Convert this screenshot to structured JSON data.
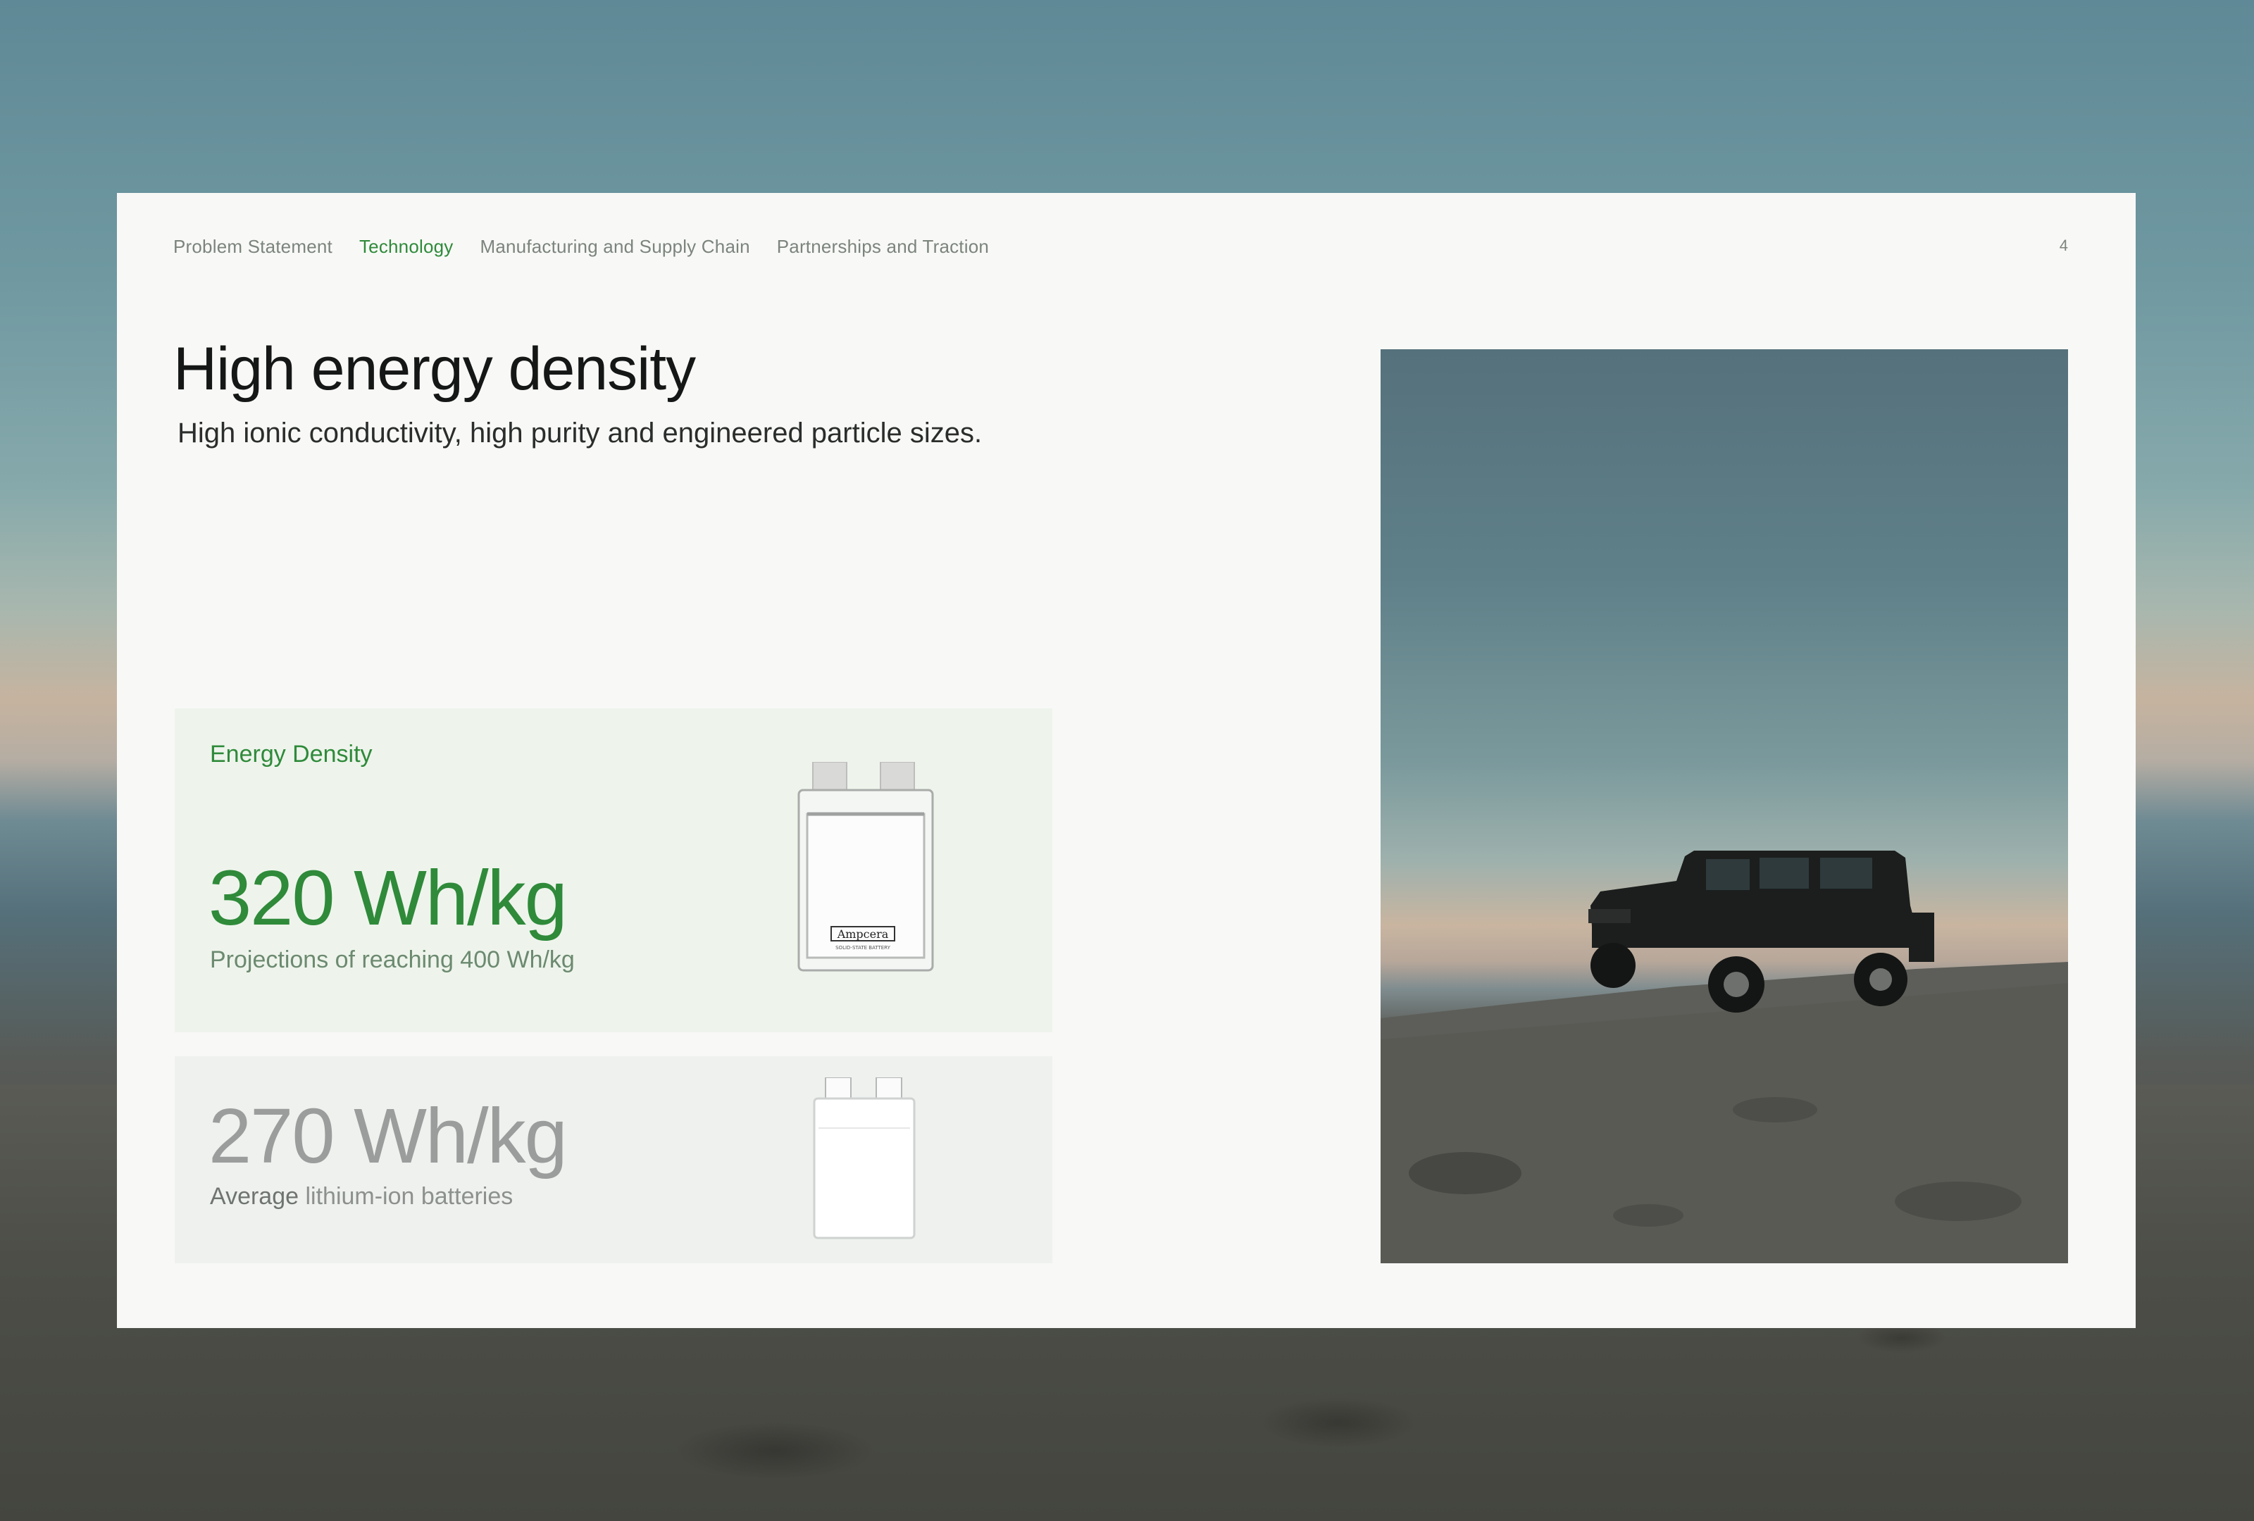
{
  "nav": {
    "items": [
      {
        "label": "Problem Statement",
        "active": false
      },
      {
        "label": "Technology",
        "active": true
      },
      {
        "label": "Manufacturing and Supply Chain",
        "active": false
      },
      {
        "label": "Partnerships and Traction",
        "active": false
      }
    ],
    "page_number": "4"
  },
  "heading": {
    "title": "High energy density",
    "subtitle": "High ionic conductivity, high purity and engineered particle sizes."
  },
  "energy_card": {
    "label": "Energy Density",
    "value": "320 Wh/kg",
    "caption": "Projections of reaching 400 Wh/kg",
    "battery_brand": "Ampcera",
    "battery_subtext": "SOLID-STATE BATTERY"
  },
  "compare_card": {
    "value": "270 Wh/kg",
    "caption_strong": "Average",
    "caption_rest": " lithium-ion batteries"
  },
  "photo": {
    "subject": "jeep-on-cliff"
  },
  "colors": {
    "accent_green": "#2f8a3a",
    "slide_bg": "#f8f9f7",
    "card_green_bg": "#eef4ec",
    "muted_grey": "#9a9d9b"
  }
}
